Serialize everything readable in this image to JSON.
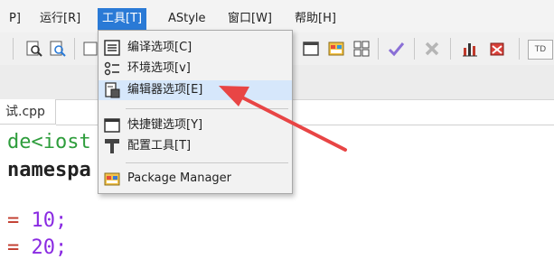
{
  "menubar": {
    "items": [
      {
        "label": "P]"
      },
      {
        "label": "运行[R]"
      },
      {
        "label": "工具[T]"
      },
      {
        "label": "AStyle"
      },
      {
        "label": "窗口[W]"
      },
      {
        "label": "帮助[H]"
      }
    ]
  },
  "tools_menu": {
    "items": [
      {
        "label": "编译选项[C]",
        "icon": "compiler-options-icon"
      },
      {
        "label": "环境选项[v]",
        "icon": "environment-options-icon"
      },
      {
        "label": "编辑器选项[E]",
        "icon": "editor-options-icon"
      },
      {
        "label": "快捷键选项[Y]",
        "icon": "shortcut-options-icon"
      },
      {
        "label": "配置工具[T]",
        "icon": "configure-tools-icon"
      },
      {
        "label": "Package Manager",
        "icon": "package-manager-icon"
      }
    ]
  },
  "editor": {
    "tab_label": "试.cpp",
    "lines": [
      {
        "text": "de<iost"
      },
      {
        "text": "namespa"
      },
      {
        "op": "=",
        "value": "10;"
      },
      {
        "op": "=",
        "value": "20;"
      }
    ]
  },
  "toolbar": {
    "right_label": "TD"
  },
  "colors": {
    "menu_active": "#2a7ad6",
    "annotation_arrow": "#e84545",
    "code_green": "#2e9d3c",
    "code_purple": "#8a2be2"
  }
}
